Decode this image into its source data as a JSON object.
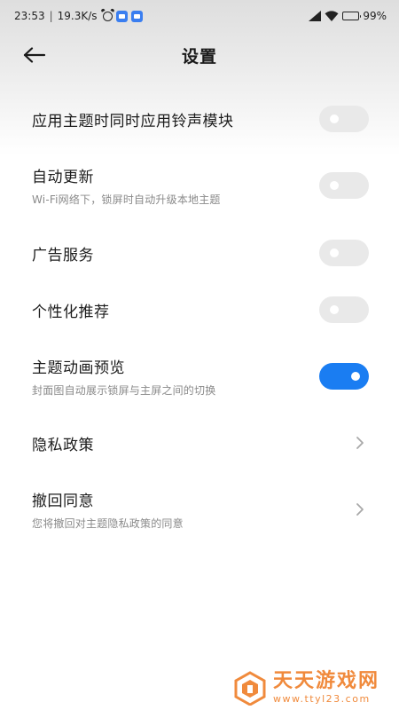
{
  "status_bar": {
    "time": "23:53",
    "net_speed": "19.3K/s",
    "battery": "99%",
    "icons": [
      "alarm-icon",
      "app-notification-icon",
      "app-notification-icon",
      "signal-icon",
      "wifi-icon",
      "battery-icon"
    ]
  },
  "header": {
    "back_icon": "arrow-left-icon",
    "title": "设置"
  },
  "settings": [
    {
      "label": "应用主题时同时应用铃声模块",
      "subtitle": "",
      "control": "toggle",
      "enabled": false
    },
    {
      "label": "自动更新",
      "subtitle": "Wi-Fi网络下，锁屏时自动升级本地主题",
      "control": "toggle",
      "enabled": false
    },
    {
      "label": "广告服务",
      "subtitle": "",
      "control": "toggle",
      "enabled": false
    },
    {
      "label": "个性化推荐",
      "subtitle": "",
      "control": "toggle",
      "enabled": false
    },
    {
      "label": "主题动画预览",
      "subtitle": "封面图自动展示锁屏与主屏之间的切换",
      "control": "toggle",
      "enabled": true
    },
    {
      "label": "隐私政策",
      "subtitle": "",
      "control": "chevron"
    },
    {
      "label": "撤回同意",
      "subtitle": "您将撤回对主题隐私政策的同意",
      "control": "chevron"
    }
  ],
  "colors": {
    "toggle_on": "#1a7df2",
    "toggle_off": "#e9e9e9",
    "watermark": "#f08a3c"
  },
  "watermark": {
    "title": "天天游戏网",
    "url": "www.ttyl23.com"
  }
}
